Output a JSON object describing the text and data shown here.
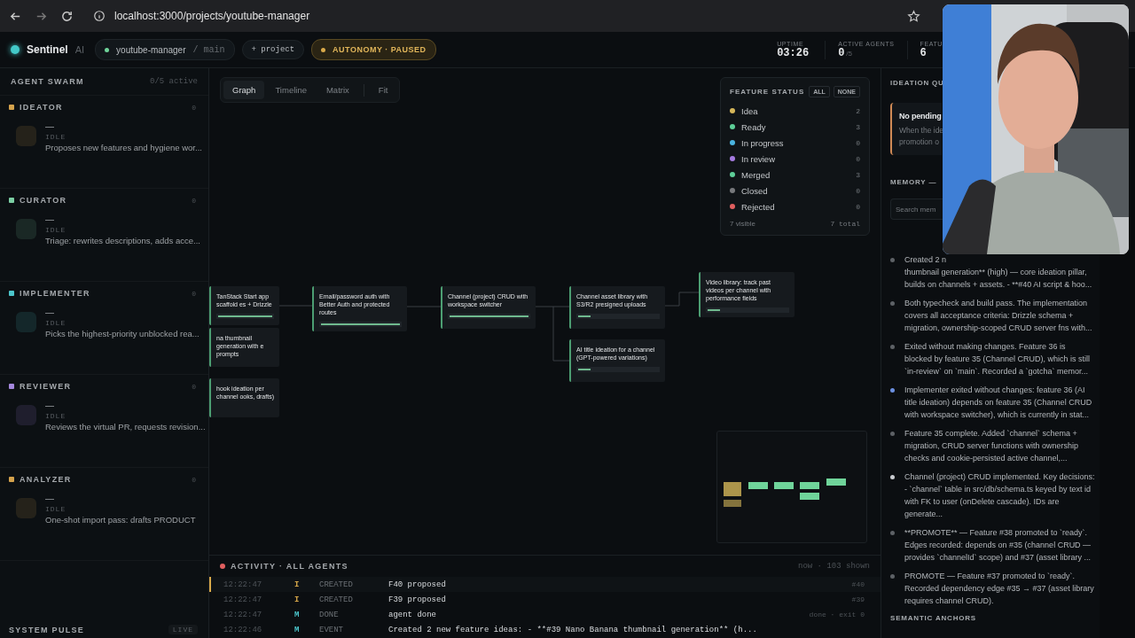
{
  "browser": {
    "url": "localhost:3000/projects/youtube-manager"
  },
  "header": {
    "brand": "Sentinel",
    "brand_suffix": "AI",
    "project": "youtube-manager",
    "branch": "/ main",
    "add_project": "+ project",
    "autonomy": "AUTONOMY · PAUSED",
    "stats": [
      {
        "label": "UPTIME",
        "value": "03:26"
      },
      {
        "label": "ACTIVE AGENTS",
        "value": "0",
        "suffix": "/5"
      },
      {
        "label": "FEATU",
        "value": "6"
      }
    ]
  },
  "sidebar": {
    "title": "AGENT SWARM",
    "active": "0/5 active",
    "agents": [
      {
        "name": "IDEATOR",
        "count": "0",
        "color": "#d4a24c",
        "task": "—",
        "status": "IDLE",
        "description": "Proposes new features and hygiene wor..."
      },
      {
        "name": "CURATOR",
        "count": "0",
        "color": "#7ccfa4",
        "task": "—",
        "status": "IDLE",
        "description": "Triage: rewrites descriptions, adds acce..."
      },
      {
        "name": "IMPLEMENTER",
        "count": "0",
        "color": "#4cc6cc",
        "task": "—",
        "status": "IDLE",
        "description": "Picks the highest-priority unblocked rea..."
      },
      {
        "name": "REVIEWER",
        "count": "0",
        "color": "#a487dd",
        "task": "—",
        "status": "IDLE",
        "description": "Reviews the virtual PR, requests revision..."
      },
      {
        "name": "ANALYZER",
        "count": "0",
        "color": "#d4a24c",
        "task": "—",
        "status": "IDLE",
        "description": "One-shot import pass: drafts PRODUCT"
      }
    ],
    "footer": {
      "title": "SYSTEM PULSE",
      "badge": "LIVE"
    }
  },
  "view_tabs": [
    {
      "label": "Graph",
      "selected": true
    },
    {
      "label": "Timeline",
      "selected": false
    },
    {
      "label": "Matrix",
      "selected": false
    }
  ],
  "fit": "Fit",
  "feature_status": {
    "title": "FEATURE STATUS",
    "buttons": [
      "ALL",
      "NONE"
    ],
    "statuses": [
      {
        "label": "Idea",
        "count": "2",
        "color": "#d6b75a"
      },
      {
        "label": "Ready",
        "count": "3",
        "color": "#5ecf98"
      },
      {
        "label": "In progress",
        "count": "0",
        "color": "#4ab4e0"
      },
      {
        "label": "In review",
        "count": "0",
        "color": "#a57be0"
      },
      {
        "label": "Merged",
        "count": "3",
        "color": "#5ecf98"
      },
      {
        "label": "Closed",
        "count": "0",
        "color": "#77797c"
      },
      {
        "label": "Rejected",
        "count": "0",
        "color": "#e05f5f"
      }
    ],
    "visible": "7 visible",
    "total": "7 total"
  },
  "graph": {
    "nodes": [
      {
        "title": "TanStack Start app scaffold es + Drizzle",
        "level": 1
      },
      {
        "title": "na thumbnail generation with e prompts"
      },
      {
        "title": "hook ideation per channel ooks, drafts)"
      },
      {
        "title": "Email/password auth with Better Auth and protected routes",
        "level": 1
      },
      {
        "title": "Channel (project) CRUD with workspace switcher",
        "level": 1
      },
      {
        "title": "Channel asset library with S3/R2 presigned uploads",
        "level": 0.15
      },
      {
        "title": "AI title ideation for a channel (GPT-powered variations)",
        "level": 0.15
      },
      {
        "title": "Video library: track past videos per channel with performance fields",
        "level": 0.15
      }
    ]
  },
  "activity": {
    "title": "ACTIVITY · ALL AGENTS",
    "meta": "now · 103 shown",
    "rows": [
      {
        "time": "12:22:47",
        "agent": "I",
        "color": "#d9a94a",
        "type": "CREATED",
        "message": "F40 proposed",
        "tag": "#40",
        "selected": true
      },
      {
        "time": "12:22:47",
        "agent": "I",
        "color": "#d9a94a",
        "type": "CREATED",
        "message": "F39 proposed",
        "tag": "#39",
        "selected": false
      },
      {
        "time": "12:22:47",
        "agent": "M",
        "color": "#4cc6cc",
        "type": "DONE",
        "message": "agent done",
        "tag": "done · exit 0",
        "selected": false
      },
      {
        "time": "12:22:46",
        "agent": "M",
        "color": "#4cc6cc",
        "type": "EVENT",
        "message": "Created 2 new feature ideas: - **#39 Nano Banana thumbnail generation** (h...",
        "selected": false
      }
    ]
  },
  "ideation": {
    "title": "IDEATION QU",
    "card": {
      "title": "No pending",
      "lines": [
        "When the ide",
        "promotion o"
      ]
    }
  },
  "memory": {
    "title": "MEMORY —",
    "placeholder": "Search mem",
    "items": [
      {
        "head": "Created 2 n",
        "text": "thumbnail generation** (high) — core ideation pillar, builds on channels + assets. - **#40 AI script & hoo...",
        "color": "#5d6166"
      },
      {
        "text": "Both typecheck and build pass. The implementation covers all acceptance criteria: Drizzle schema + migration, ownership-scoped CRUD server fns with...",
        "color": "#5d6166"
      },
      {
        "text": "Exited without making changes. Feature 36 is blocked by feature 35 (Channel CRUD), which is still `in-review` on `main`. Recorded a `gotcha` memor...",
        "color": "#5d6166"
      },
      {
        "text": "Implementer exited without changes: feature 36 (AI title ideation) depends on feature 35 (Channel CRUD with workspace switcher), which is currently in stat...",
        "color": "#6b8fe0"
      },
      {
        "text": "Feature 35 complete. Added `channel` schema + migration, CRUD server functions with ownership checks and cookie-persisted active channel,...",
        "color": "#5d6166"
      },
      {
        "text": "Channel (project) CRUD implemented. Key decisions: - `channel` table in src/db/schema.ts keyed by text id with FK to user (onDelete cascade). IDs are generate...",
        "color": "#c9ccd0"
      },
      {
        "text": "**PROMOTE** — Feature #38 promoted to `ready`. Edges recorded: depends on #35 (channel CRUD — provides `channelId` scope) and #37 (asset library ...",
        "color": "#5d6166"
      },
      {
        "text": "PROMOTE — Feature #37 promoted to `ready`. Recorded dependency edge #35 → #37 (asset library requires channel CRUD).",
        "color": "#5d6166"
      }
    ]
  },
  "semantic_anchors": "SEMANTIC ANCHORS"
}
